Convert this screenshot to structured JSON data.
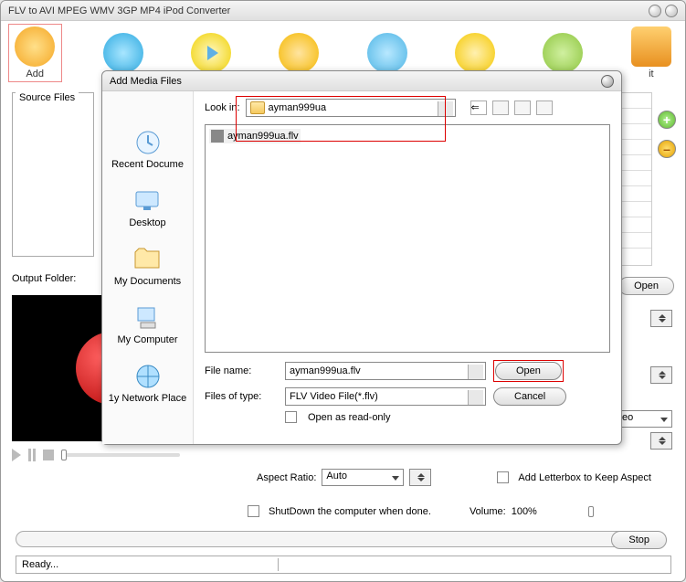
{
  "window": {
    "title": "FLV to AVI MPEG WMV 3GP MP4 iPod Converter"
  },
  "toolbar": {
    "add": "Add",
    "exit_partial": "it"
  },
  "labels": {
    "source_files": "Source Files",
    "output_folder": "Output Folder:",
    "aspect_ratio": "Aspect Ratio:",
    "add_letterbox": "Add Letterbox to Keep Aspect",
    "shutdown": "ShutDown the computer when done.",
    "volume": "Volume:",
    "volume_value": "100%",
    "stop": "Stop",
    "open_side": "Open",
    "status": "Ready...",
    "video_partial": "eo"
  },
  "settings": {
    "aspect_value": "Auto"
  },
  "dialog": {
    "title": "Add Media Files",
    "look_in": "Look in:",
    "folder": "ayman999ua",
    "file_item": "ayman999ua.flv",
    "sidebar": {
      "recent": "Recent Docume",
      "desktop": "Desktop",
      "mydocs": "My Documents",
      "mycomp": "My Computer",
      "mynet": "1y Network Place"
    },
    "filename_label": "File name:",
    "filename_value": "ayman999ua.flv",
    "filetype_label": "Files of type:",
    "filetype_value": "FLV Video File(*.flv)",
    "readonly": "Open as read-only",
    "open": "Open",
    "cancel": "Cancel"
  }
}
